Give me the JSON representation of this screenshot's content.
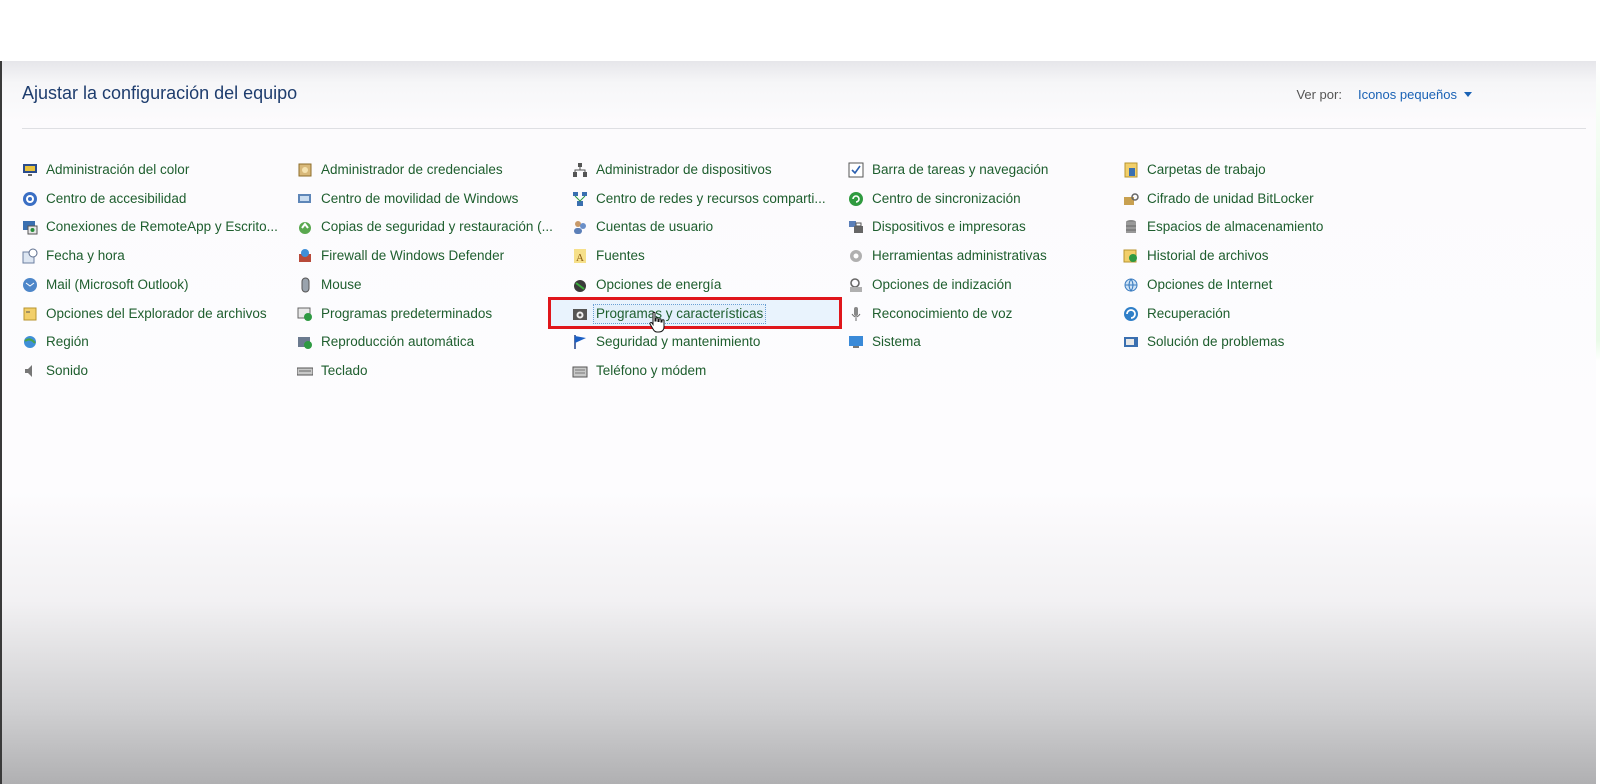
{
  "header": {
    "title": "Ajustar la configuración del equipo",
    "view_by_label": "Ver por:",
    "view_by_value": "Iconos pequeños"
  },
  "columns": [
    {
      "items": [
        {
          "label": "Administración del color",
          "icon": "color-management-icon"
        },
        {
          "label": "Centro de accesibilidad",
          "icon": "accessibility-icon"
        },
        {
          "label": "Conexiones de RemoteApp y Escrito...",
          "icon": "remoteapp-icon"
        },
        {
          "label": "Fecha y hora",
          "icon": "clock-icon"
        },
        {
          "label": "Mail (Microsoft Outlook)",
          "icon": "mail-icon"
        },
        {
          "label": "Opciones del Explorador de archivos",
          "icon": "folder-options-icon"
        },
        {
          "label": "Región",
          "icon": "globe-icon"
        },
        {
          "label": "Sonido",
          "icon": "speaker-icon"
        }
      ]
    },
    {
      "items": [
        {
          "label": "Administrador de credenciales",
          "icon": "credential-vault-icon"
        },
        {
          "label": "Centro de movilidad de Windows",
          "icon": "mobility-icon"
        },
        {
          "label": "Copias de seguridad y restauración (...",
          "icon": "backup-icon"
        },
        {
          "label": "Firewall de Windows Defender",
          "icon": "firewall-icon"
        },
        {
          "label": "Mouse",
          "icon": "mouse-icon"
        },
        {
          "label": "Programas predeterminados",
          "icon": "default-programs-icon"
        },
        {
          "label": "Reproducción automática",
          "icon": "autoplay-icon"
        },
        {
          "label": "Teclado",
          "icon": "keyboard-icon"
        }
      ]
    },
    {
      "items": [
        {
          "label": "Administrador de dispositivos",
          "icon": "device-manager-icon"
        },
        {
          "label": "Centro de redes y recursos comparti...",
          "icon": "network-icon"
        },
        {
          "label": "Cuentas de usuario",
          "icon": "users-icon"
        },
        {
          "label": "Fuentes",
          "icon": "fonts-icon"
        },
        {
          "label": "Opciones de energía",
          "icon": "power-icon"
        },
        {
          "label": "Programas y características",
          "icon": "programs-icon"
        },
        {
          "label": "Seguridad y mantenimiento",
          "icon": "flag-icon"
        },
        {
          "label": "Teléfono y módem",
          "icon": "phone-modem-icon"
        }
      ]
    },
    {
      "items": [
        {
          "label": "Barra de tareas y navegación",
          "icon": "taskbar-icon"
        },
        {
          "label": "Centro de sincronización",
          "icon": "sync-icon"
        },
        {
          "label": "Dispositivos e impresoras",
          "icon": "printer-icon"
        },
        {
          "label": "Herramientas administrativas",
          "icon": "admin-tools-icon"
        },
        {
          "label": "Opciones de indización",
          "icon": "indexing-icon"
        },
        {
          "label": "Reconocimiento de voz",
          "icon": "microphone-icon"
        },
        {
          "label": "Sistema",
          "icon": "computer-icon"
        }
      ]
    },
    {
      "items": [
        {
          "label": "Carpetas de trabajo",
          "icon": "work-folders-icon"
        },
        {
          "label": "Cifrado de unidad BitLocker",
          "icon": "bitlocker-icon"
        },
        {
          "label": "Espacios de almacenamiento",
          "icon": "storage-icon"
        },
        {
          "label": "Historial de archivos",
          "icon": "file-history-icon"
        },
        {
          "label": "Opciones de Internet",
          "icon": "internet-options-icon"
        },
        {
          "label": "Recuperación",
          "icon": "recovery-icon"
        },
        {
          "label": "Solución de problemas",
          "icon": "troubleshoot-icon"
        }
      ]
    }
  ],
  "selected_item": "Programas y características",
  "colors": {
    "title": "#1e3d6e",
    "link": "#1e5e2e",
    "accent_blue": "#1a62b5",
    "highlight_border": "#e0161b"
  }
}
